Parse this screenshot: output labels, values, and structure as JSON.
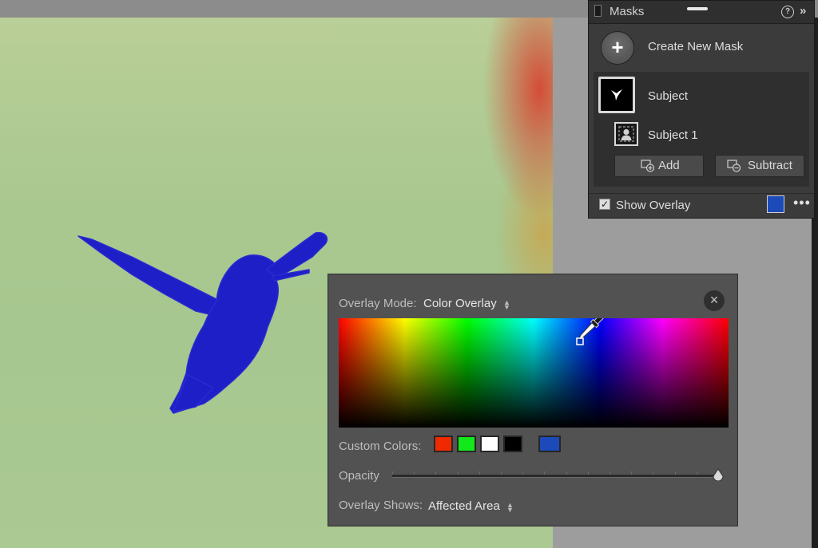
{
  "canvas": {
    "overlay_color": "#1f1fc8",
    "background_color": "#a9c890"
  },
  "masks_panel": {
    "title": "Masks",
    "help_glyph": "?",
    "collapse_glyph": "»",
    "create_new_mask": "Create New Mask",
    "create_glyph": "+",
    "mask": {
      "name": "Subject",
      "component": "Subject 1",
      "add_label": "Add",
      "subtract_label": "Subtract"
    },
    "show_overlay": {
      "label": "Show Overlay",
      "checked": true,
      "check_glyph": "✓",
      "swatch_color": "#1c4ab8",
      "more_glyph": "•••"
    }
  },
  "overlay_popup": {
    "mode_label": "Overlay Mode:",
    "mode_value": "Color Overlay",
    "close_glyph": "×",
    "custom_colors_label": "Custom Colors:",
    "custom_colors": [
      "#f02a00",
      "#13e81a",
      "#ffffff",
      "#000000"
    ],
    "selected_color": "#1c4ab8",
    "opacity_label": "Opacity",
    "opacity_value": 1.0,
    "shows_label": "Overlay Shows:",
    "shows_value": "Affected Area",
    "updown_glyph": "⬍"
  },
  "icons": {
    "eyedropper": "eyedropper-icon",
    "add": "add-mask-icon",
    "subtract": "subtract-mask-icon",
    "subject": "person-icon"
  }
}
